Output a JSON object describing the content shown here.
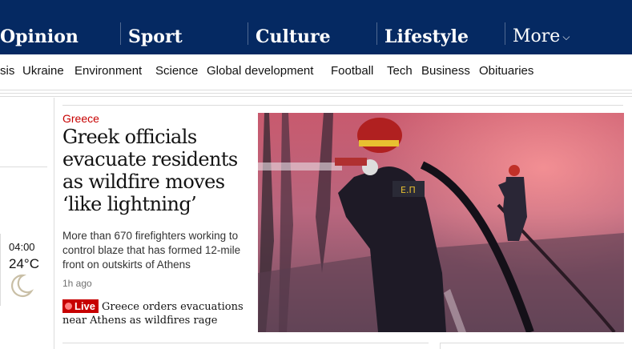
{
  "pillars": [
    {
      "label": "Opinion"
    },
    {
      "label": "Sport"
    },
    {
      "label": "Culture"
    },
    {
      "label": "Lifestyle"
    }
  ],
  "more_label": "More",
  "subnav": [
    "sis",
    "Ukraine",
    "Environment",
    "Science",
    "Global development",
    "Football",
    "Tech",
    "Business",
    "Obituaries"
  ],
  "weather": {
    "time": "04:00",
    "temp": "24°C",
    "icon": "moon-icon"
  },
  "story": {
    "kicker": "Greece",
    "headline": "Greek officials evacuate residents as wildfire moves ‘like lightning’",
    "standfirst": "More than 670 firefighters working to control blaze that has formed 12-mile front on outskirts of Athens",
    "age": "1h ago",
    "live_label": "Live",
    "live_text": "Greece orders evacuations near Athens as wildfires rage"
  },
  "colors": {
    "brand": "#052962",
    "kicker": "#c70000",
    "live": "#c70000"
  }
}
